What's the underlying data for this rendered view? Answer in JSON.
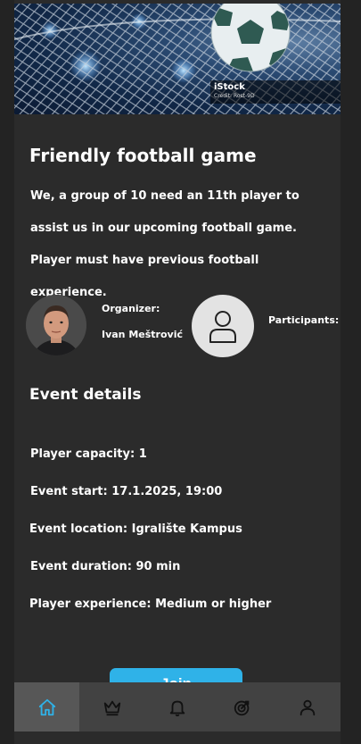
{
  "hero": {
    "watermark_brand": "iStock",
    "watermark_credit": "Credit: Rost-9D"
  },
  "event": {
    "title": "Friendly football game",
    "description": "We, a group of 10 need an 11th player to assist us in our upcoming football game. Player must have previous football experience."
  },
  "organizer": {
    "label": "Organizer:",
    "name": "Ivan Meštrović"
  },
  "participants": {
    "label": "Participants:"
  },
  "details": {
    "heading": "Event details",
    "capacity": "Player capacity: 1",
    "start": "Event start: 17.1.2025, 19:00",
    "location": "Event location: Igralište Kampus",
    "duration": "Event duration: 90 min",
    "experience": "Player experience: Medium or higher"
  },
  "actions": {
    "join_label": "Join"
  },
  "nav": {
    "items": [
      "home-icon",
      "crown-icon",
      "bell-icon",
      "target-icon",
      "profile-icon"
    ],
    "active": "home-icon",
    "active_color": "#2fb2e8"
  }
}
